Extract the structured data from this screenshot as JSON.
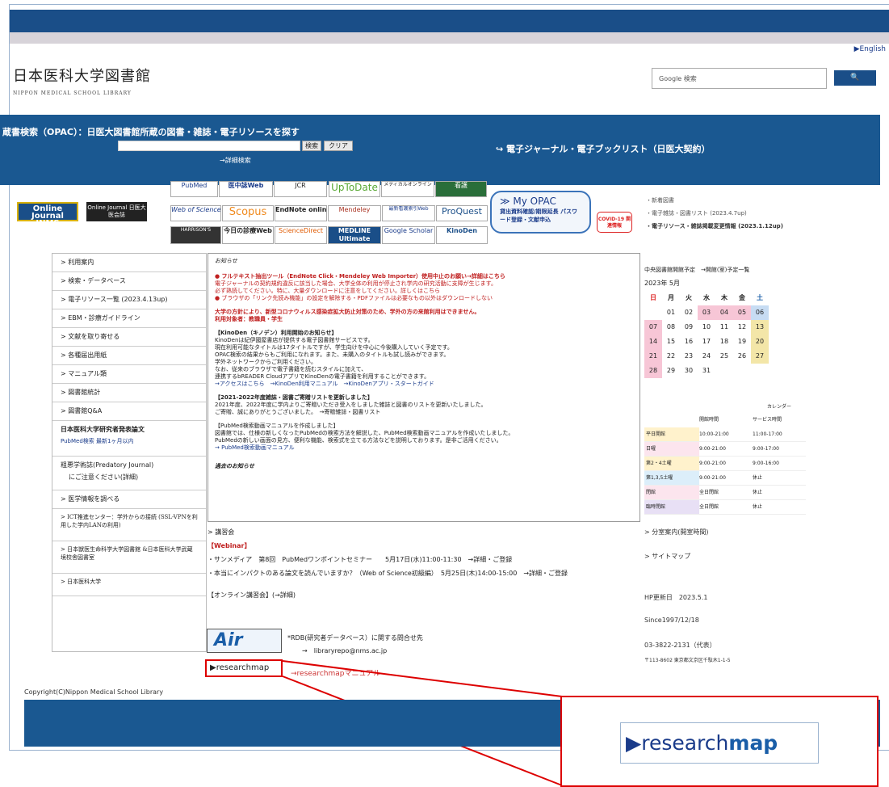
{
  "header": {
    "english": "▶English",
    "logo_jp": "日本医科大学図書館",
    "logo_en": "NIPPON MEDICAL SCHOOL LIBRARY",
    "google_placeholder": "Google 検索",
    "google_btn": "🔍"
  },
  "opac": {
    "title": "蔵書検索（OPAC）：日医大図書館所蔵の図書・雑誌・電子リソースを探す",
    "search_btn": "検索",
    "clear_btn": "クリア",
    "detail": "→詳細検索",
    "ejournal": "↪ 電子ジャーナル・電子ブックリスト（日医大契約）"
  },
  "banners": {
    "pubmed": "PubMed",
    "ichushi": "医中誌Web",
    "jcr": "JCR",
    "uptodate": "UpToDate",
    "medical_online": "メディカルオンライン",
    "kango": "看護",
    "wos": "Web of Science",
    "scopus": "Scopus",
    "endnote": "EndNote online",
    "mendeley": "Mendeley",
    "meteo": "最新看護索引Web",
    "proquest": "ProQuest",
    "harrison": "HARRISON'S",
    "kyounoshinryou": "今日の診療Web",
    "sciencedirect": "ScienceDirect",
    "medline": "MEDLINE Ultimate",
    "scholar": "Google Scholar",
    "kinoden": "KinoDen",
    "jnms": "Online Journal JNMS",
    "jnms2": "Online Journal 日医大医会誌"
  },
  "myopac": {
    "title": "≫ My OPAC",
    "sub": "貸出資料確認/期限延長 パスワード登録・文献申込"
  },
  "covid": "COVID-19 関連情報",
  "news_right": [
    "・新着図書",
    "・電子雑誌・図書リスト (2023.4.7up)",
    "・電子リソース・雑誌掲載変更情報 (2023.1.12up)"
  ],
  "nav": [
    "> 利用案内",
    "> 検索・データベース",
    "> 電子リソース一覧 (2023.4.13up)",
    "> EBM・診療ガイドライン",
    "> 文献を取り寄せる",
    "> 各種届出用紙",
    "> マニュアル類",
    "> 図書館統計",
    "> 図書館Q&A",
    "日本医科大学研究者発表論文",
    "PubMed検索 最新1ヶ月以内",
    "粗悪学術誌(Predatory Journal)",
    "にご注意ください(詳細)",
    "> 医学情報を調べる",
    "> ICT推進センター：学外からの接続 (SSL-VPNを利用した学内LANの利用)",
    "> 日本獣医生命科学大学図書館 &日本医科大学武蔵境校舎図書室",
    "> 日本医科大学"
  ],
  "notice": {
    "heading": "お知らせ",
    "p1": "● フルテキスト抽出ツール（EndNote Click・Mendeley Web Importer）使用中止のお願い→詳細はこちら",
    "p1b": "電子ジャーナルの契約規約違反に該当した場合、大学全体の利用が停止され学内の研究活動に支障が生じます。",
    "p1c": "必ず熟読してください。特に、大量ダウンロードに注意をしてください。詳しくはこちら",
    "p1d": "● ブラウザの「リンク先読み機能」の設定を解除する・PDFファイルは必要なもの以外はダウンロードしない",
    "p2": "大学の方針により、新型コロナウィルス感染症拡大防止対策のため、学外の方の来館利用はできません。",
    "p2b": "利用対象者：教職員・学生",
    "p3": "【KinoDen（キノデン）利用開始のお知らせ】",
    "p3b": "KinoDenは紀伊國屋書店が提供する電子図書館サービスです。",
    "p3c": "現在利用可能なタイトルは17タイトルですが、学生向けを中心に今後購入していく予定です。",
    "p3d": "OPAC検索の結果からもご利用になれます。また、未購入のタイトルも試し読みができます。",
    "p3e": "学外ネットワークからご利用ください。",
    "p3f": "なお、従来のブラウザで電子書籍を読むスタイルに加えて、",
    "p3g": "連携するbREADER CloudアプリでKinoDenの電子書籍を利用することができます。",
    "p3h": "→アクセスはこちら　→KinoDen利用マニュアル　→KinoDenアプリ・スタートガイド",
    "p4": "【2021-2022年度雑誌・図書ご寄贈リストを更新しました】",
    "p4b": "2021年度、2022年度に学内よりご寄贈いただき受入をしました雑誌と図書のリストを更新いたしました。",
    "p4c": "ご寄贈、誠にありがとうございました。　→寄贈雑誌・図書リスト",
    "p5": "【PubMed検索動画マニュアルを作成しました】",
    "p5b": "図書館では、仕様の新しくなったPubMedの検索方法を解説した、PubMed検索動画マニュアルを作成いたしました。",
    "p5c": "PubMedの新しい画面の見方、便利な機能、検索式を立てる方法などを説明しております。是非ご活用ください。",
    "p5d": "→ PubMed検索動画マニュアル",
    "past": "過去のお知らせ"
  },
  "calendar": {
    "title": "中央図書館開館予定　→開館(室)予定一覧",
    "month": "2023年 5月",
    "days": [
      "日",
      "月",
      "火",
      "水",
      "木",
      "金",
      "土"
    ],
    "weeks": [
      [
        "",
        "01",
        "02",
        "03",
        "04",
        "05",
        "06"
      ],
      [
        "07",
        "08",
        "09",
        "10",
        "11",
        "12",
        "13"
      ],
      [
        "14",
        "15",
        "16",
        "17",
        "18",
        "19",
        "20"
      ],
      [
        "21",
        "22",
        "23",
        "24",
        "25",
        "26",
        "27"
      ],
      [
        "28",
        "29",
        "30",
        "31",
        "",
        "",
        ""
      ]
    ]
  },
  "hours": {
    "label": "カレンダー",
    "cols": [
      "開館時間",
      "サービス時間"
    ],
    "rows": [
      [
        "平日開館",
        "10:00-21:00",
        "11:00-17:00"
      ],
      [
        "日曜",
        "9:00-21:00",
        "9:00-17:00"
      ],
      [
        "第2・4土曜",
        "9:00-21:00",
        "9:00-16:00"
      ],
      [
        "第1,3,5土曜",
        "9:00-21:00",
        "休止"
      ],
      [
        "閉館",
        "全日閉館",
        "休止"
      ],
      [
        "臨時閉館",
        "全日閉館",
        "休止"
      ]
    ]
  },
  "right_links": {
    "branch": "> 分室案内(開室時間)",
    "sitemap": "> サイトマップ",
    "updated": "HP更新日　2023.5.1",
    "since": "Since1997/12/18",
    "address": "03-3822-2131（代表）",
    "post": "〒113-8602 東京都文京区千駄木1-1-5"
  },
  "lecture": {
    "head": "> 講習会",
    "webinar": "【Webinar】",
    "l1": "・サンメディア　第8回　PubMedワンポイントセミナー　　5月17日(水)11:00-11:30　→詳細・ご登録",
    "l2": "・本当にインパクトのある論文を読んでいますか？（Web of Science初級編）　5月25日(木)14:00-15:00　→詳細・ご登録",
    "online": "【オンライン講習会】(→詳細)"
  },
  "air": {
    "logo": "Air",
    "text1": "*RDB(研究者データベース）に関する問合せ先",
    "text2": "→　libraryrepo@nms.ac.jp"
  },
  "researchmap": {
    "small": "▶researchmap",
    "manual": "→researchmapマニュアル",
    "callout_a": "▶research",
    "callout_b": "map"
  },
  "footer": {
    "copyright": "Copyright(C)Nippon Medical School Library"
  }
}
